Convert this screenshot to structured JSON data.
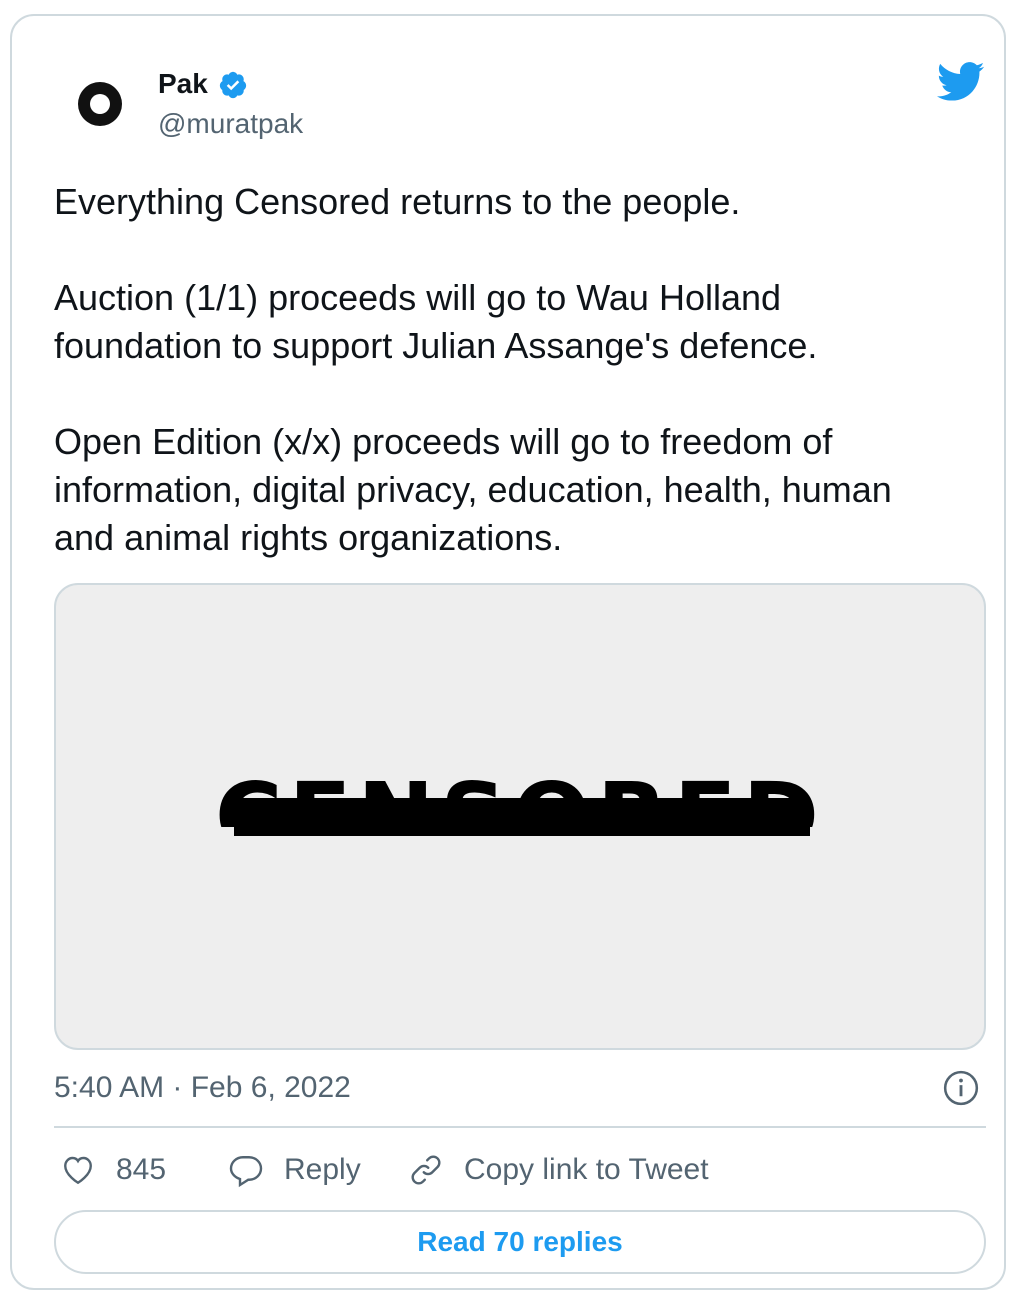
{
  "author": {
    "name": "Pak",
    "handle": "@muratpak",
    "verified": true,
    "avatar_icon": "circle-ring-avatar"
  },
  "brand_icon": "twitter-bird-icon",
  "tweet": {
    "paragraphs": [
      "Everything Censored returns to the people.",
      "Auction (1/1) proceeds will go to Wau Holland\nfoundation to support Julian Assange's defence.",
      "Open Edition (x/x) proceeds will go to freedom of\ninformation, digital privacy, education, health, human\nand animal rights organizations."
    ],
    "media_text": "CENSORED",
    "timestamp": "5:40 AM · Feb 6, 2022"
  },
  "actions": {
    "like_count": "845",
    "reply_label": "Reply",
    "copy_label": "Copy link to Tweet"
  },
  "read_replies_label": "Read 70 replies",
  "colors": {
    "accent": "#1d9bf0",
    "text": "#0f1419",
    "secondary": "#536471",
    "border": "#cfd9de",
    "media_bg": "#eeeeee"
  }
}
